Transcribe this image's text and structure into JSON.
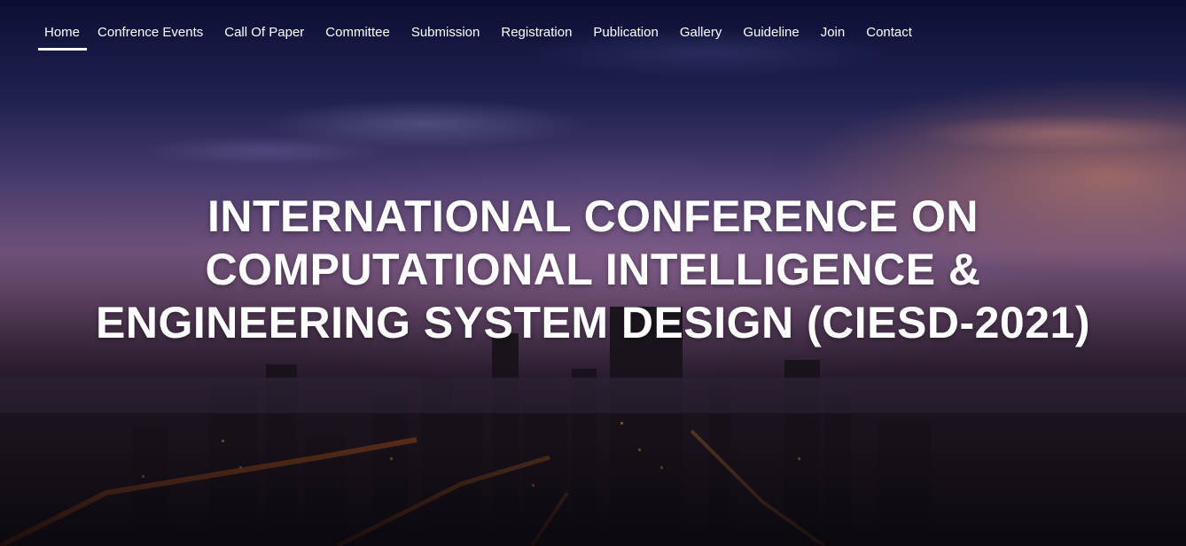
{
  "nav": {
    "items": [
      {
        "label": "Home",
        "active": true
      },
      {
        "label": "Confrence Events",
        "active": false
      },
      {
        "label": "Call Of Paper",
        "active": false
      },
      {
        "label": "Committee",
        "active": false
      },
      {
        "label": "Submission",
        "active": false
      },
      {
        "label": "Registration",
        "active": false
      },
      {
        "label": "Publication",
        "active": false
      },
      {
        "label": "Gallery",
        "active": false
      },
      {
        "label": "Guideline",
        "active": false
      },
      {
        "label": "Join",
        "active": false
      },
      {
        "label": "Contact",
        "active": false
      }
    ]
  },
  "hero": {
    "title_lines": [
      "INTERNATIONAL CONFERENCE ON",
      "COMPUTATIONAL INTELLIGENCE &",
      "ENGINEERING SYSTEM DESIGN (CIESD-2021)"
    ]
  },
  "colors": {
    "text": "#ffffff",
    "sky_top": "#0c0f33",
    "sky_mid": "#6e5078",
    "city_lights": "#f07828"
  }
}
